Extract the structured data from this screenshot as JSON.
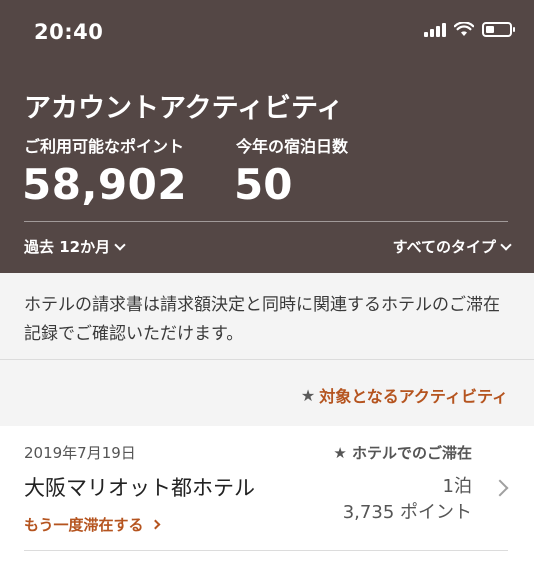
{
  "status": {
    "time": "20:40"
  },
  "header": {
    "title": "アカウントアクティビティ",
    "points_label": "ご利用可能なポイント",
    "points_value": "58,902",
    "nights_label": "今年の宿泊日数",
    "nights_value": "50",
    "period_filter": "過去 12か月",
    "type_filter": "すべてのタイプ"
  },
  "notice": {
    "text": "ホテルの請求書は請求額決定と同時に関連するホテルのご滞在記録でご確認いただけます。"
  },
  "eligible": {
    "star": "★",
    "label": "対象となるアクティビティ"
  },
  "activities": [
    {
      "date": "2019年7月19日",
      "type": "★ ホテルでのご滞在",
      "hotel": "大阪マリオット都ホテル",
      "nights": "1泊",
      "points": "3,735 ポイント",
      "stay_again": "もう一度滞在する"
    }
  ],
  "colors": {
    "header_bg": "#544745",
    "accent": "#b5541f",
    "notice_bg": "#f4f4f4"
  },
  "icons": {
    "signal": "cellular-signal-icon",
    "wifi": "wifi-icon",
    "battery": "battery-icon",
    "battery_level": 0.35
  }
}
